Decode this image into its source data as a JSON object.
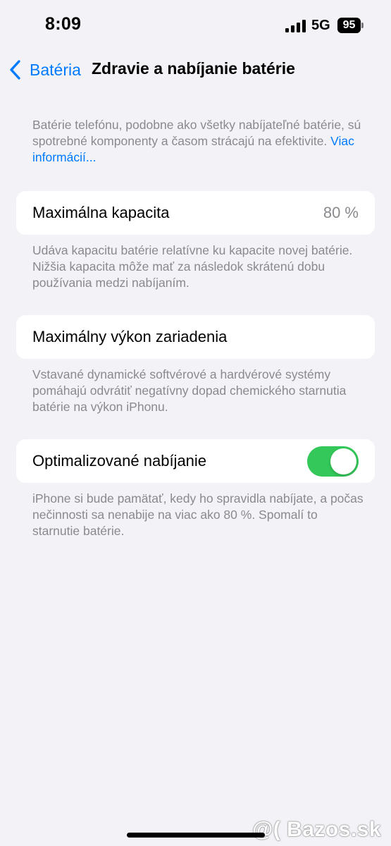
{
  "status_bar": {
    "time": "8:09",
    "network": "5G",
    "battery_level": "95",
    "signal_icon": "cellular-signal-icon"
  },
  "nav": {
    "back_label": "Batéria",
    "title": "Zdravie a nabíjanie batérie",
    "back_icon": "chevron-left-icon"
  },
  "intro": {
    "text": "Batérie telefónu, podobne ako všetky nabíjateľné batérie, sú spotrebné komponenty a časom strácajú na efektivite. ",
    "link": "Viac informácií..."
  },
  "max_capacity": {
    "label": "Maximálna kapacita",
    "value": "80 %",
    "caption": "Udáva kapacitu batérie relatívne ku kapacite novej batérie. Nižšia kapacita môže mať za následok skrátenú dobu používania medzi nabíjaním."
  },
  "peak_performance": {
    "label": "Maximálny výkon zariadenia",
    "caption": "Vstavané dynamické softvérové a hardvérové systémy pomáhajú odvrátiť negatívny dopad chemického starnutia batérie na výkon iPhonu."
  },
  "optimized_charging": {
    "label": "Optimalizované nabíjanie",
    "enabled": true,
    "caption": "iPhone si bude pamätať, kedy ho spravidla nabíjate, a počas nečinnosti sa nenabije na viac ako 80 %. Spomalí to starnutie batérie."
  },
  "watermark": "@( Bazos.sk",
  "colors": {
    "background": "#f2f2f7",
    "accent": "#007aff",
    "toggle_on": "#34c759",
    "secondary_text": "#8a8a8e"
  }
}
